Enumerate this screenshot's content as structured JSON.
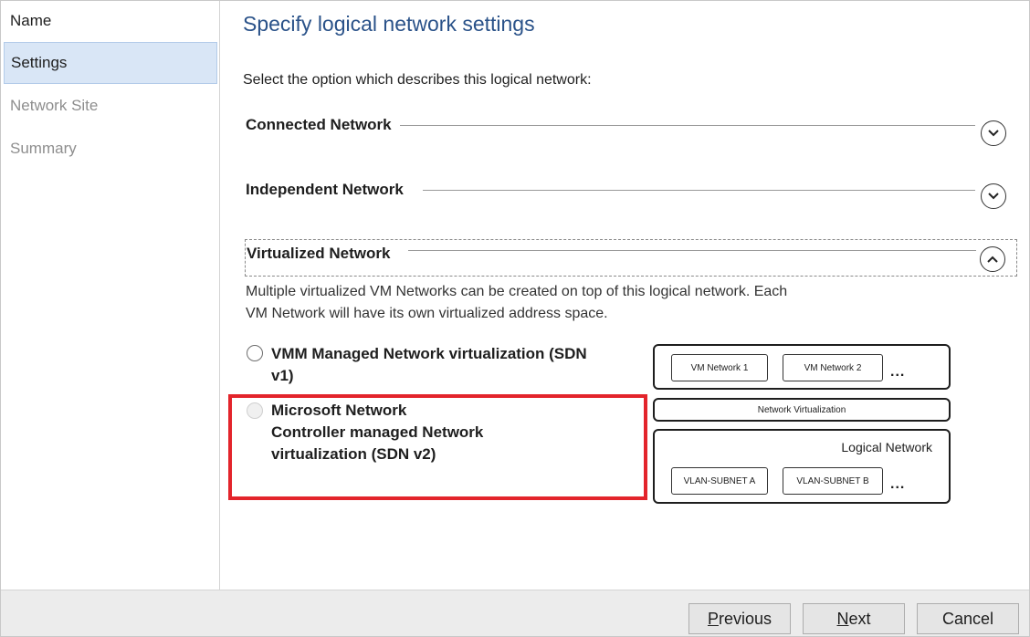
{
  "sidebar": {
    "items": [
      {
        "label": "Name",
        "state": "normal"
      },
      {
        "label": "Settings",
        "state": "selected"
      },
      {
        "label": "Network Site",
        "state": "disabled"
      },
      {
        "label": "Summary",
        "state": "disabled"
      }
    ]
  },
  "main": {
    "title": "Specify logical network settings",
    "prompt": "Select the option which describes this logical network:",
    "sections": [
      {
        "title": "Connected Network",
        "expanded": false,
        "icon": "chevron-down-icon"
      },
      {
        "title": "Independent Network",
        "expanded": false,
        "icon": "chevron-down-icon"
      },
      {
        "title": "Virtualized Network",
        "expanded": true,
        "icon": "chevron-up-icon"
      }
    ],
    "virtualized": {
      "description_line1": "Multiple virtualized VM Networks can be created on top of this logical network. Each",
      "description_line2": "VM Network will have its own virtualized address space.",
      "option1_line1": "VMM Managed Network virtualization (SDN",
      "option1_line2": "v1)",
      "option2_line1": "Microsoft Network",
      "option2_line2": "Controller managed Network",
      "option2_line3": "virtualization (SDN v2)"
    },
    "diagram": {
      "vm_network_1": "VM Network 1",
      "vm_network_2": "VM Network 2",
      "ellipsis": "...",
      "network_virtualization": "Network Virtualization",
      "logical_network": "Logical  Network",
      "vlan_a": "VLAN-SUBNET A",
      "vlan_b": "VLAN-SUBNET B"
    },
    "highlight_color": "#e3242b"
  },
  "footer": {
    "previous_rest": "revious",
    "previous_key": "P",
    "next_rest": "ext",
    "next_key": "N",
    "cancel": "Cancel"
  }
}
